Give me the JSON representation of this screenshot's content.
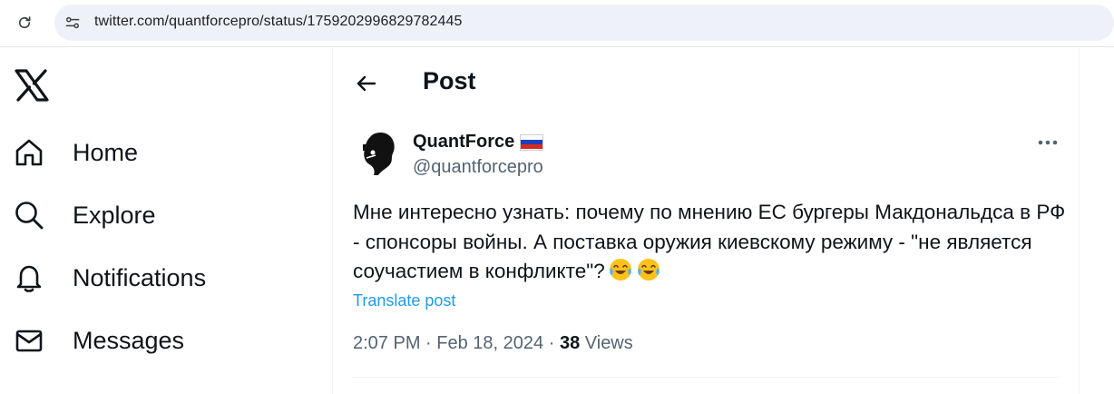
{
  "browser": {
    "url": "twitter.com/quantforcepro/status/1759202996829782445"
  },
  "nav": {
    "items": [
      {
        "label": "Home",
        "icon": "home-icon"
      },
      {
        "label": "Explore",
        "icon": "search-icon"
      },
      {
        "label": "Notifications",
        "icon": "bell-icon"
      },
      {
        "label": "Messages",
        "icon": "envelope-icon"
      }
    ]
  },
  "post": {
    "header_title": "Post",
    "author": {
      "name": "QuantForce",
      "handle": "@quantforcepro",
      "flag": "russia-flag"
    },
    "text": "Мне интересно узнать: почему по мнению ЕС бургеры Макдональдса в РФ - спонсоры войны. А поставка оружия киевскому режиму - \"не является соучастием в конфликте\"?",
    "emojis": [
      "face-with-tears-of-joy",
      "face-with-tears-of-joy"
    ],
    "translate_label": "Translate post",
    "time": "2:07 PM",
    "separator": "·",
    "date": "Feb 18, 2024",
    "views_count": "38",
    "views_label": "Views"
  },
  "colors": {
    "link": "#1d9bf0",
    "secondary_text": "#536471",
    "primary_text": "#0f1419"
  }
}
